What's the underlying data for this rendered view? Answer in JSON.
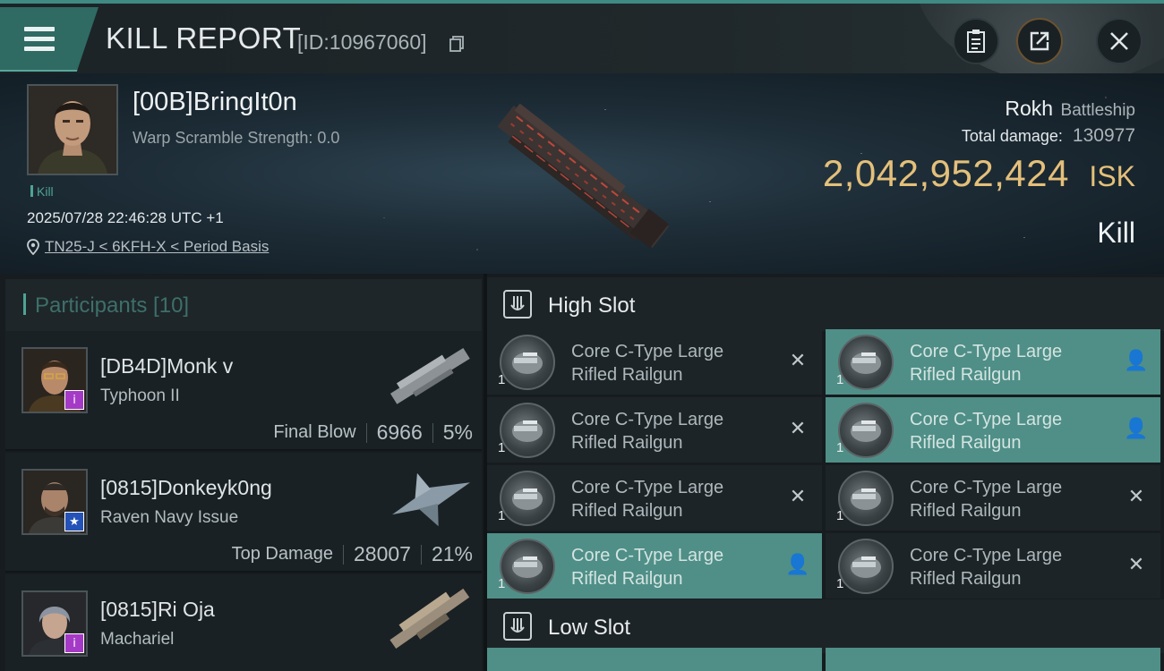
{
  "header": {
    "title": "KILL REPORT",
    "report_id": "[ID:10967060]",
    "icons": [
      "menu-icon",
      "copy-icon",
      "clipboard-icon",
      "share-icon",
      "close-icon"
    ]
  },
  "victim": {
    "name": "[00B]BringIt0n",
    "warp_scramble": "Warp Scramble Strength: 0.0",
    "tag": "Kill",
    "datetime": "2025/07/28 22:46:28 UTC +1",
    "location": "TN25-J < 6KFH-X < Period Basis",
    "ship_name": "Rokh",
    "ship_class": "Battleship",
    "total_damage_label": "Total damage:",
    "total_damage": "130977",
    "isk_value": "2,042,952,424",
    "isk_unit": "ISK",
    "result": "Kill"
  },
  "participants": {
    "header": "Participants [10]",
    "rows": [
      {
        "name": "[DB4D]Monk v",
        "ship": "Typhoon II",
        "stat_label": "Final Blow",
        "damage": "6966",
        "percent": "5%",
        "badge": "i",
        "badge_color": "#a53ac7"
      },
      {
        "name": "[0815]Donkeyk0ng",
        "ship": "Raven Navy Issue",
        "stat_label": "Top Damage",
        "damage": "28007",
        "percent": "21%",
        "badge": "★",
        "badge_color": "#2453b8"
      },
      {
        "name": "[0815]Ri Oja",
        "ship": "Machariel",
        "stat_label": "",
        "damage": "",
        "percent": "",
        "badge": "i",
        "badge_color": "#a53ac7"
      }
    ]
  },
  "fittings": {
    "high_slot_label": "High Slot",
    "low_slot_label": "Low Slot",
    "high_slot_modules": [
      {
        "line1": "Core C-Type Large",
        "line2": "Rifled Railgun",
        "qty": "1",
        "state": "destroyed",
        "glyph": "✕"
      },
      {
        "line1": "Core C-Type Large",
        "line2": "Rifled Railgun",
        "qty": "1",
        "state": "dropped",
        "glyph": "👤"
      },
      {
        "line1": "Core C-Type Large",
        "line2": "Rifled Railgun",
        "qty": "1",
        "state": "destroyed",
        "glyph": "✕"
      },
      {
        "line1": "Core C-Type Large",
        "line2": "Rifled Railgun",
        "qty": "1",
        "state": "dropped",
        "glyph": "👤"
      },
      {
        "line1": "Core C-Type Large",
        "line2": "Rifled Railgun",
        "qty": "1",
        "state": "destroyed",
        "glyph": "✕"
      },
      {
        "line1": "Core C-Type Large",
        "line2": "Rifled Railgun",
        "qty": "1",
        "state": "destroyed",
        "glyph": "✕"
      },
      {
        "line1": "Core C-Type Large",
        "line2": "Rifled Railgun",
        "qty": "1",
        "state": "dropped",
        "glyph": "👤"
      },
      {
        "line1": "Core C-Type Large",
        "line2": "Rifled Railgun",
        "qty": "1",
        "state": "destroyed",
        "glyph": "✕"
      }
    ]
  },
  "colors": {
    "accent": "#4f8f87",
    "isk_gold": "#e4c07a",
    "background": "#161c1f"
  }
}
